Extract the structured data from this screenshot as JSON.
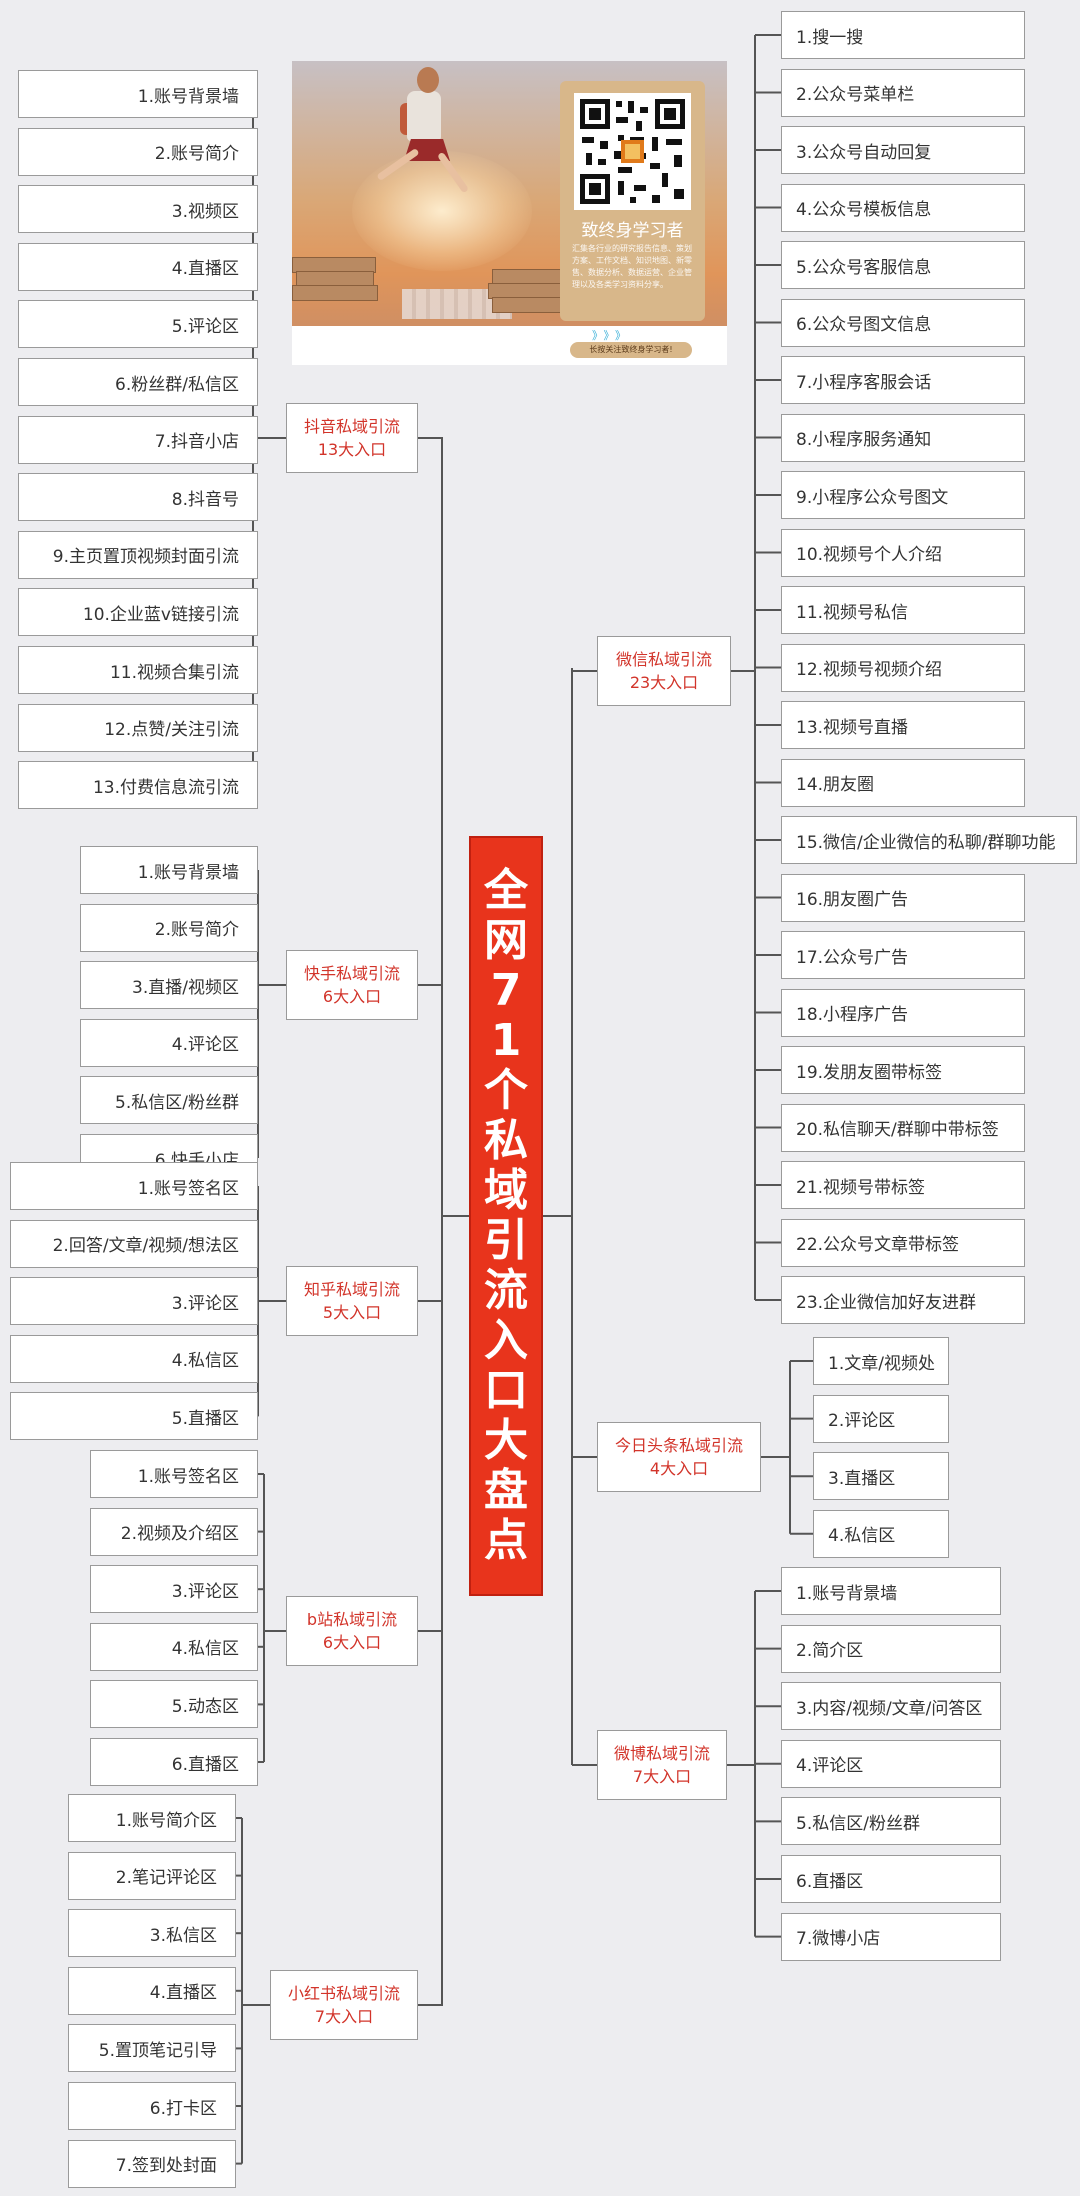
{
  "title": "全网71个私域引流入口大盘点",
  "ad": {
    "card_title": "致终身学习者",
    "card_desc": "汇集各行业的研究报告信息、策划方案、工作文档、知识地图、新零售、数据分析、数据运营、企业管理以及各类学习资料分享。",
    "button_label": "长按关注致终身学习者!",
    "marks": "》》》"
  },
  "branches": [
    {
      "id": "douyin",
      "title": "抖音私域引流",
      "subtitle": "13大入口",
      "side": "left",
      "items": [
        "1.账号背景墙",
        "2.账号简介",
        "3.视频区",
        "4.直播区",
        "5.评论区",
        "6.粉丝群/私信区",
        "7.抖音小店",
        "8.抖音号",
        "9.主页置顶视频封面引流",
        "10.企业蓝v链接引流",
        "11.视频合集引流",
        "12.点赞/关注引流",
        "13.付费信息流引流"
      ]
    },
    {
      "id": "kuaishou",
      "title": "快手私域引流",
      "subtitle": "6大入口",
      "side": "left",
      "items": [
        "1.账号背景墙",
        "2.账号简介",
        "3.直播/视频区",
        "4.评论区",
        "5.私信区/粉丝群",
        "6.快手小店"
      ]
    },
    {
      "id": "zhihu",
      "title": "知乎私域引流",
      "subtitle": "5大入口",
      "side": "left",
      "items": [
        "1.账号签名区",
        "2.回答/文章/视频/想法区",
        "3.评论区",
        "4.私信区",
        "5.直播区"
      ]
    },
    {
      "id": "bilibili",
      "title": "b站私域引流",
      "subtitle": "6大入口",
      "side": "left",
      "items": [
        "1.账号签名区",
        "2.视频及介绍区",
        "3.评论区",
        "4.私信区",
        "5.动态区",
        "6.直播区"
      ]
    },
    {
      "id": "xiaohongshu",
      "title": "小红书私域引流",
      "subtitle": "7大入口",
      "side": "left",
      "items": [
        "1.账号简介区",
        "2.笔记评论区",
        "3.私信区",
        "4.直播区",
        "5.置顶笔记引导",
        "6.打卡区",
        "7.签到处封面"
      ]
    },
    {
      "id": "wechat",
      "title": "微信私域引流",
      "subtitle": "23大入口",
      "side": "right",
      "items": [
        "1.搜一搜",
        "2.公众号菜单栏",
        "3.公众号自动回复",
        "4.公众号模板信息",
        "5.公众号客服信息",
        "6.公众号图文信息",
        "7.小程序客服会话",
        "8.小程序服务通知",
        "9.小程序公众号图文",
        "10.视频号个人介绍",
        "11.视频号私信",
        "12.视频号视频介绍",
        "13.视频号直播",
        "14.朋友圈",
        "15.微信/企业微信的私聊/群聊功能",
        "16.朋友圈广告",
        "17.公众号广告",
        "18.小程序广告",
        "19.发朋友圈带标签",
        "20.私信聊天/群聊中带标签",
        "21.视频号带标签",
        "22.公众号文章带标签",
        "23.企业微信加好友进群"
      ]
    },
    {
      "id": "toutiao",
      "title": "今日头条私域引流",
      "subtitle": "4大入口",
      "side": "right",
      "items": [
        "1.文章/视频处",
        "2.评论区",
        "3.直播区",
        "4.私信区"
      ]
    },
    {
      "id": "weibo",
      "title": "微博私域引流",
      "subtitle": "7大入口",
      "side": "right",
      "items": [
        "1.账号背景墙",
        "2.简介区",
        "3.内容/视频/文章/问答区",
        "4.评论区",
        "5.私信区/粉丝群",
        "6.直播区",
        "7.微博小店"
      ]
    }
  ]
}
